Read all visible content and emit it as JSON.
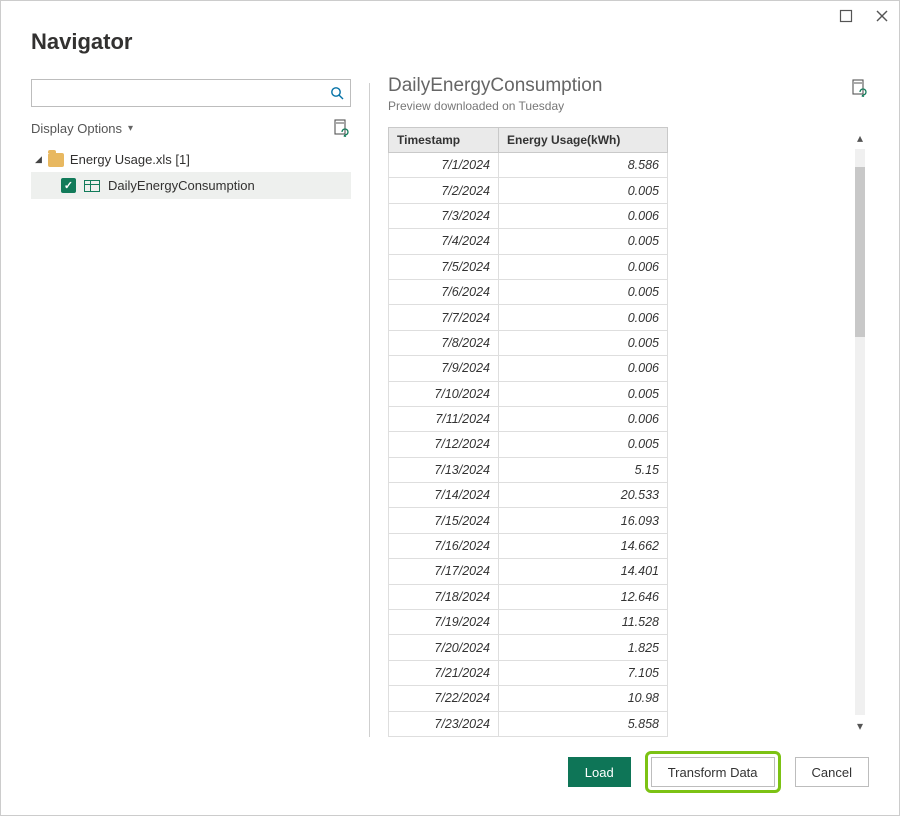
{
  "window": {
    "title": "Navigator"
  },
  "sidebar": {
    "search_placeholder": "",
    "display_options_label": "Display Options",
    "file_label": "Energy Usage.xls [1]",
    "item_label": "DailyEnergyConsumption"
  },
  "preview": {
    "title": "DailyEnergyConsumption",
    "subtitle": "Preview downloaded on Tuesday",
    "columns": [
      "Timestamp",
      "Energy Usage(kWh)"
    ],
    "rows": [
      {
        "ts": "7/1/2024",
        "val": "8.586"
      },
      {
        "ts": "7/2/2024",
        "val": "0.005"
      },
      {
        "ts": "7/3/2024",
        "val": "0.006"
      },
      {
        "ts": "7/4/2024",
        "val": "0.005"
      },
      {
        "ts": "7/5/2024",
        "val": "0.006"
      },
      {
        "ts": "7/6/2024",
        "val": "0.005"
      },
      {
        "ts": "7/7/2024",
        "val": "0.006"
      },
      {
        "ts": "7/8/2024",
        "val": "0.005"
      },
      {
        "ts": "7/9/2024",
        "val": "0.006"
      },
      {
        "ts": "7/10/2024",
        "val": "0.005"
      },
      {
        "ts": "7/11/2024",
        "val": "0.006"
      },
      {
        "ts": "7/12/2024",
        "val": "0.005"
      },
      {
        "ts": "7/13/2024",
        "val": "5.15"
      },
      {
        "ts": "7/14/2024",
        "val": "20.533"
      },
      {
        "ts": "7/15/2024",
        "val": "16.093"
      },
      {
        "ts": "7/16/2024",
        "val": "14.662"
      },
      {
        "ts": "7/17/2024",
        "val": "14.401"
      },
      {
        "ts": "7/18/2024",
        "val": "12.646"
      },
      {
        "ts": "7/19/2024",
        "val": "11.528"
      },
      {
        "ts": "7/20/2024",
        "val": "1.825"
      },
      {
        "ts": "7/21/2024",
        "val": "7.105"
      },
      {
        "ts": "7/22/2024",
        "val": "10.98"
      },
      {
        "ts": "7/23/2024",
        "val": "5.858"
      }
    ]
  },
  "buttons": {
    "load": "Load",
    "transform": "Transform Data",
    "cancel": "Cancel"
  }
}
